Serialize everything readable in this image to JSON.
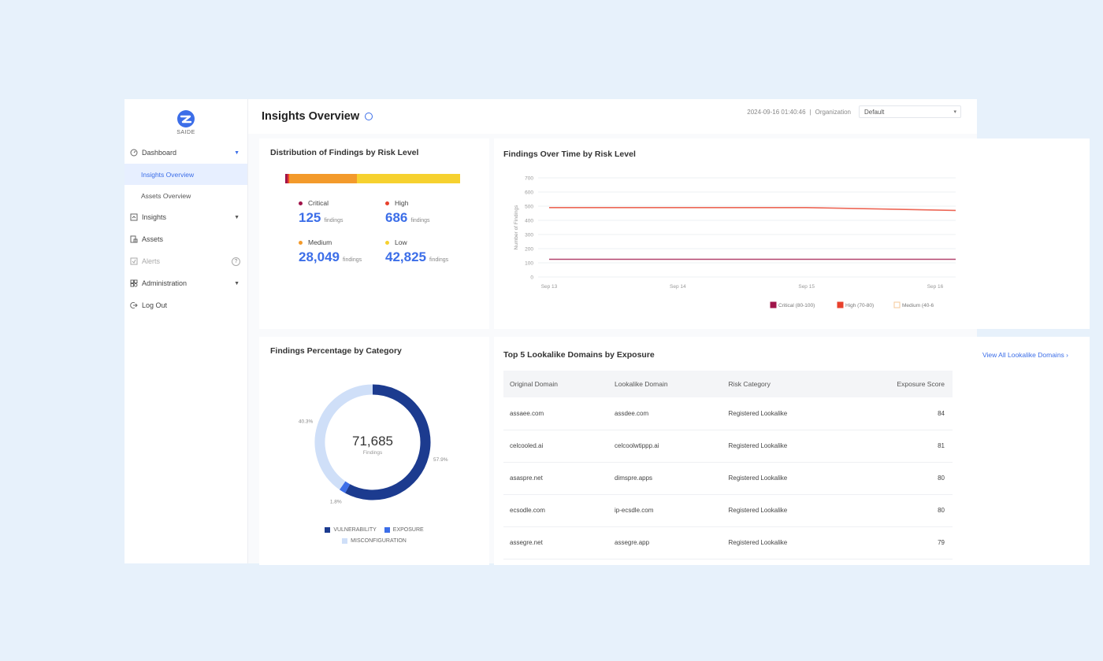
{
  "brand": {
    "name": "SAIDE"
  },
  "sidebar": {
    "items": [
      {
        "label": "Dashboard",
        "icon": "dashboard-icon"
      },
      {
        "label": "Insights Overview"
      },
      {
        "label": "Assets Overview"
      },
      {
        "label": "Insights",
        "icon": "insights-icon"
      },
      {
        "label": "Assets",
        "icon": "assets-icon"
      },
      {
        "label": "Alerts",
        "icon": "alerts-icon"
      },
      {
        "label": "Administration",
        "icon": "admin-icon"
      },
      {
        "label": "Log Out",
        "icon": "logout-icon"
      }
    ]
  },
  "header": {
    "title": "Insights Overview",
    "timestamp": "2024-09-16 01:40:46",
    "separator": "|",
    "org_label": "Organization",
    "org_value": "Default"
  },
  "distribution": {
    "title": "Distribution of Findings by Risk Level",
    "unit": "findings",
    "levels": [
      {
        "label": "Critical",
        "value": "125",
        "raw": 125,
        "color": "#a0144a"
      },
      {
        "label": "High",
        "value": "686",
        "raw": 686,
        "color": "#e8412c"
      },
      {
        "label": "Medium",
        "value": "28,049",
        "raw": 28049,
        "color": "#f39a2b"
      },
      {
        "label": "Low",
        "value": "42,825",
        "raw": 42825,
        "color": "#f6d12f"
      }
    ]
  },
  "line_chart": {
    "title": "Findings Over Time by Risk Level",
    "ylabel": "Number of Findings",
    "legend": [
      "Critical (80-100)",
      "High (70-80)",
      "Medium (40-6"
    ],
    "colors": [
      "#a0144a",
      "#e8412c",
      "#f6c89a"
    ]
  },
  "donut": {
    "title": "Findings Percentage by Category",
    "total": "71,685",
    "total_label": "Findings",
    "slices": [
      {
        "label": "VULNERABILITY",
        "pct": "57.9%",
        "value": 57.9,
        "color": "#1c3b8f"
      },
      {
        "label": "EXPOSURE",
        "pct": "1.8%",
        "value": 1.8,
        "color": "#3c6ee8"
      },
      {
        "label": "MISCONFIGURATION",
        "pct": "40.3%",
        "value": 40.3,
        "color": "#cfdff8"
      }
    ]
  },
  "table": {
    "title": "Top 5 Lookalike Domains by Exposure",
    "view_all": "View All Lookalike Domains ›",
    "columns": [
      "Original Domain",
      "Lookalike Domain",
      "Risk Category",
      "Exposure Score"
    ],
    "rows": [
      [
        "assaee.com",
        "assdee.com",
        "Registered Lookalike",
        "84"
      ],
      [
        "celcooled.ai",
        "celcoolwtippp.ai",
        "Registered Lookalike",
        "81"
      ],
      [
        "asaspre.net",
        "dimspre.apps",
        "Registered Lookalike",
        "80"
      ],
      [
        "ecsodle.com",
        "ip-ecsdle.com",
        "Registered Lookalike",
        "80"
      ],
      [
        "assegre.net",
        "assegre.app",
        "Registered Lookalike",
        "79"
      ]
    ]
  },
  "chart_data": [
    {
      "type": "line",
      "title": "Findings Over Time by Risk Level",
      "ylabel": "Number of Findings",
      "x": [
        "Sep 13",
        "Sep 14",
        "Sep 15",
        "Sep 16"
      ],
      "ylim": [
        0,
        700
      ],
      "yticks": [
        0,
        100,
        200,
        300,
        400,
        500,
        600,
        700
      ],
      "series": [
        {
          "name": "Critical (80-100)",
          "color": "#a0144a",
          "values": [
            125,
            125,
            125,
            125
          ]
        },
        {
          "name": "High (70-80)",
          "color": "#e8412c",
          "values": [
            490,
            490,
            490,
            470
          ]
        },
        {
          "name": "Medium (40-6",
          "color": "#f6c89a",
          "values": []
        }
      ],
      "legend": "bottom-right",
      "grid": true
    },
    {
      "type": "pie",
      "title": "Findings Percentage by Category",
      "categories": [
        "VULNERABILITY",
        "EXPOSURE",
        "MISCONFIGURATION"
      ],
      "values": [
        57.9,
        1.8,
        40.3
      ]
    }
  ]
}
